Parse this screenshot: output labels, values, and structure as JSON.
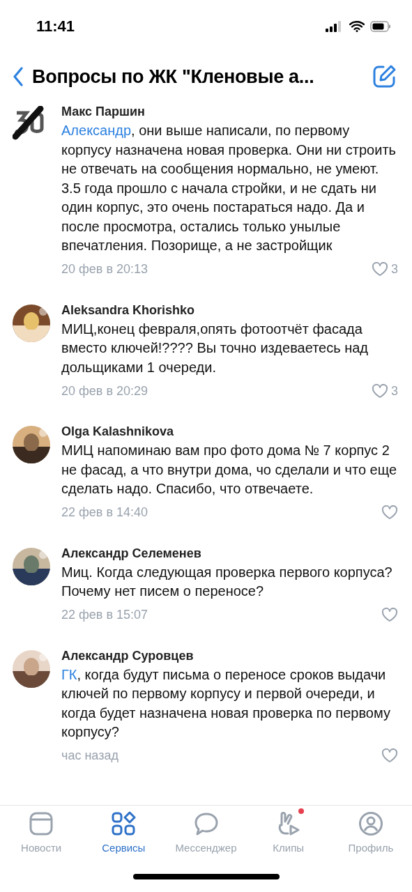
{
  "status_bar": {
    "time": "11:41"
  },
  "header": {
    "title": "Вопросы по ЖК \"Кленовые а..."
  },
  "comments": [
    {
      "author": "Макс Паршин",
      "kind": "logo",
      "mention": "Александр",
      "text": ", они выше написали, по первому корпусу назначена новая проверка. Они ни строить не отвечать на сообщения нормально, не умеют. 3.5 года прошло с начала стройки, и не сдать ни один корпус, это очень постараться надо. Да и после просмотра, остались только унылые впечатления. Позорище, а не застройщик",
      "time": "20 фев в 20:13",
      "likes": "3"
    },
    {
      "author": "Aleksandra Khorishko",
      "kind": "picture",
      "text": "МИЦ,конец февраля,опять фотоотчёт фасада вместо ключей!???? Вы точно издеваетесь над дольщиками 1 очереди.",
      "time": "20 фев в 20:29",
      "likes": "3"
    },
    {
      "author": "Olga Kalashnikova",
      "kind": "picture",
      "text": "МИЦ напоминаю вам про фото дома № 7 корпус 2 не фасад, а что внутри дома, чо сделали и что еще сделать надо. Спасибо, что отвечаете.",
      "time": "22 фев в 14:40"
    },
    {
      "author": "Александр Селеменев",
      "kind": "picture",
      "text": "Миц. Когда следующая проверка первого корпуса? Почему нет писем о переносе?",
      "time": "22 фев в 15:07"
    },
    {
      "author": "Александр Суровцев",
      "kind": "picture",
      "mention": "ГК",
      "text": ", когда будут письма о переносе сроков выдачи ключей по первому корпусу и первой очереди, и когда будет назначена новая проверка по первому корпусу?",
      "time": "час назад"
    }
  ],
  "tab_bar": [
    {
      "label": "Новости",
      "kind": "news",
      "selected": false,
      "badge": false
    },
    {
      "label": "Сервисы",
      "kind": "services",
      "selected": true,
      "badge": false
    },
    {
      "label": "Мессенджер",
      "kind": "chat",
      "selected": false,
      "badge": false
    },
    {
      "label": "Клипы",
      "kind": "clips",
      "selected": false,
      "badge": true
    },
    {
      "label": "Профиль",
      "kind": "profile",
      "selected": false,
      "badge": false
    }
  ]
}
